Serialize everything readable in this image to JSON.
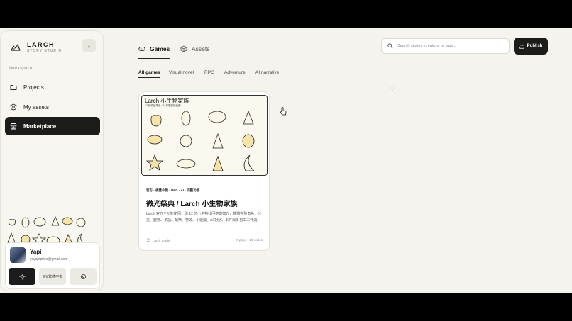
{
  "app": {
    "name": "LARCH",
    "subtitle": "STORY STUDIO"
  },
  "sidebar": {
    "section_label": "Workspace",
    "items": [
      {
        "label": "Projects",
        "icon": "folder-icon"
      },
      {
        "label": "My assets",
        "icon": "badge-icon"
      },
      {
        "label": "Marketplace",
        "icon": "store-icon"
      }
    ],
    "user": {
      "name": "Yapi",
      "email": "yayapipihre@gmail.com"
    },
    "controls": {
      "theme_icon": "sun-icon",
      "language": "EN  繁體中文",
      "settings_icon": "gear-icon"
    }
  },
  "header": {
    "tabs": [
      {
        "label": "Games",
        "icon": "gamepad-icon"
      },
      {
        "label": "Assets",
        "icon": "box-icon"
      }
    ],
    "search_placeholder": "Search stories, creators, or tags...",
    "publish_label": "Publish"
  },
  "filters": [
    "All games",
    "Visual novel",
    "RPG",
    "Adventure",
    "AI narrative"
  ],
  "card": {
    "image_title": "Larch 小生物家族",
    "image_subtitle": "12 款原創角色 / AI 部署劇情遊戲",
    "tags": "官方 · 視覺小說 · RPG · AI · 完整功能",
    "title": "微光祭典 / Larch 小生物家族",
    "description": "Larch 官方全功能範例，與 12 位小生物找回祭典微光，體驗完整角色、分支、變數、多語、配樂、特效、小遊戲、AI 對話、事件與多自由工作流。",
    "author": "Larch Studio",
    "stats": "0 plays · 20 nodes"
  },
  "colors": {
    "accent": "#1c1c1a",
    "background": "#f4f3ee"
  }
}
